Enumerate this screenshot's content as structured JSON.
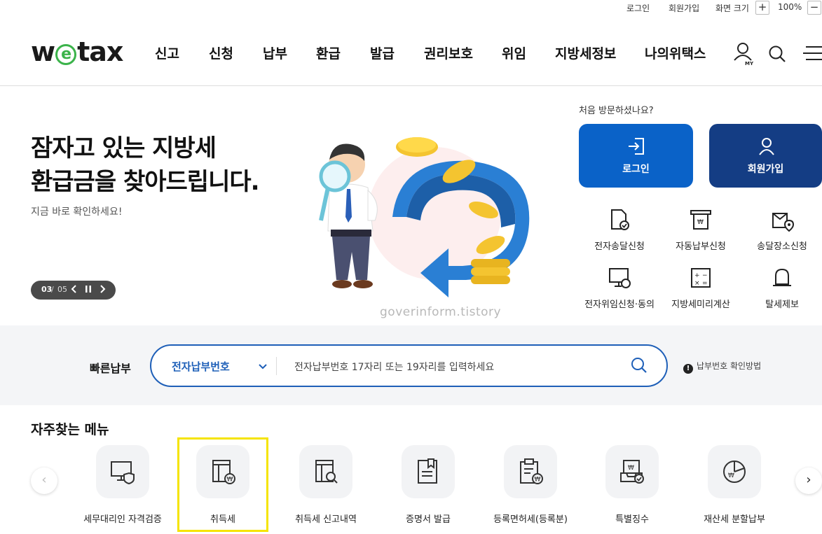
{
  "util": {
    "login": "로그인",
    "signup": "회원가입",
    "screen_size": "화면 크기",
    "plus": "+",
    "zoom": "100%",
    "minus": "−"
  },
  "header": {
    "logo_w": "w",
    "logo_e": "e",
    "logo_tax": "tax",
    "nav": [
      "신고",
      "신청",
      "납부",
      "환급",
      "발급",
      "권리보호",
      "위임",
      "지방세정보",
      "나의위택스"
    ],
    "my_label": "MY"
  },
  "hero": {
    "title_line1": "잠자고 있는 지방세",
    "title_line2": "환급금을 찾아드립니다.",
    "subtitle": "지금 바로 확인하세요!",
    "pager_current": "03",
    "pager_sep": " / ",
    "pager_total": "05"
  },
  "watermark": "goverinform.tistory",
  "side": {
    "first_visit": "처음 방문하셨나요?",
    "login_btn": "로그인",
    "signup_btn": "회원가입",
    "quick": [
      "전자송달신청",
      "자동납부신청",
      "송달장소신청",
      "전자위임신청·동의",
      "지방세미리계산",
      "탈세제보"
    ]
  },
  "fastpay": {
    "title": "빠른납부",
    "select_value": "전자납부번호",
    "placeholder": "전자납부번호 17자리 또는 19자리를 입력하세요",
    "help": "납부번호 확인방법",
    "help_mark": "!"
  },
  "frequent": {
    "title": "자주찾는 메뉴",
    "items": [
      "세무대리인 자격검증",
      "취득세",
      "취득세 신고내역",
      "증명서 발급",
      "등록면허세(등록분)",
      "특별징수",
      "재산세 분할납부"
    ],
    "prev": "‹",
    "next": "›"
  },
  "colors": {
    "primary_blue": "#0a62c8",
    "navy": "#143d84",
    "logo_green": "#3bb34a",
    "highlight": "#f5e400"
  }
}
